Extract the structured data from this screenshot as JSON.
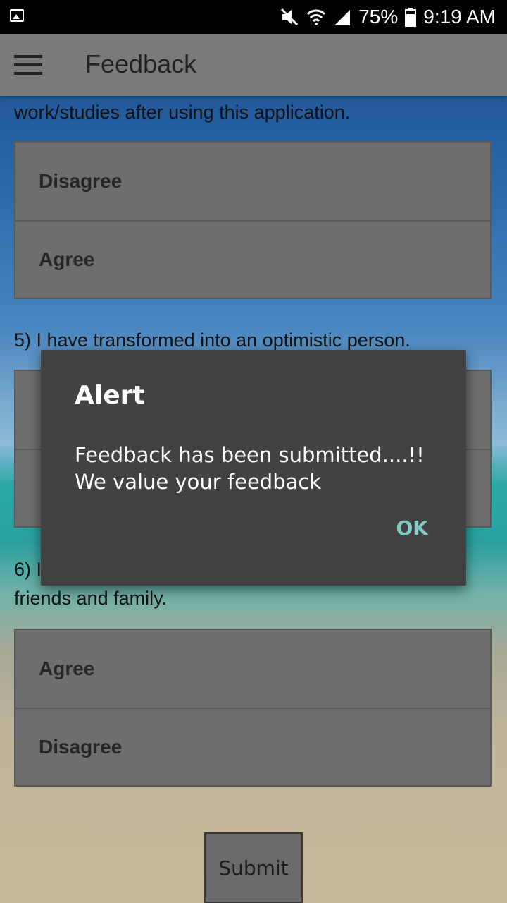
{
  "status_bar": {
    "battery": "75%",
    "time": "9:19 AM",
    "icons": [
      "image-icon",
      "mute-icon",
      "wifi-icon",
      "signal-icon",
      "battery-icon"
    ]
  },
  "app_bar": {
    "title": "Feedback",
    "menu_icon": "hamburger-menu-icon"
  },
  "questions": {
    "q4_tail": "work/studies after using this application.",
    "q4_options": [
      "Disagree",
      "Agree"
    ],
    "q5": "5) I have transformed into an optimistic person.",
    "q6_prefix": "6) I",
    "q6_tail": "friends and family.",
    "q6_options": [
      "Agree",
      "Disagree"
    ]
  },
  "submit_label": "Submit",
  "dialog": {
    "title": "Alert",
    "message_line1": "Feedback has been submitted....!!",
    "message_line2": "We value your feedback",
    "ok_label": "OK"
  },
  "colors": {
    "dialog_bg": "#424242",
    "ok_accent": "#80cbc4",
    "app_bar": "#7a7a7a"
  }
}
